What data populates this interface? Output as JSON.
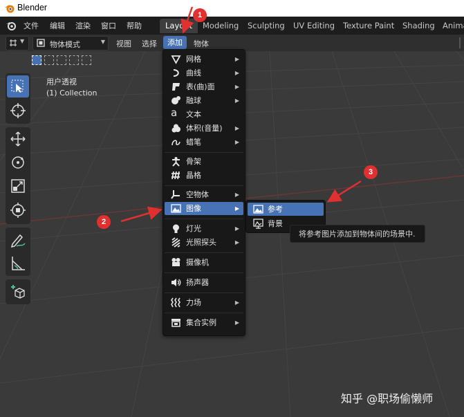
{
  "titlebar": {
    "title": "Blender"
  },
  "menubar": {
    "items": [
      "文件",
      "编辑",
      "渲染",
      "窗口",
      "帮助"
    ],
    "workspaces": [
      "Layout",
      "Modeling",
      "Sculpting",
      "UV Editing",
      "Texture Paint",
      "Shading",
      "Anima"
    ]
  },
  "toolbar": {
    "mode": "物体模式",
    "view": "视图",
    "select": "选择",
    "add": "添加",
    "object": "物体"
  },
  "viewport": {
    "title": "用户透视",
    "collection": "(1) Collection"
  },
  "add_menu": {
    "items": [
      {
        "label": "网格",
        "icon": "mesh-icon",
        "submenu": true
      },
      {
        "label": "曲线",
        "icon": "curve-icon",
        "submenu": true
      },
      {
        "label": "表(曲)面",
        "icon": "surface-icon",
        "submenu": true
      },
      {
        "label": "融球",
        "icon": "metaball-icon",
        "submenu": true
      },
      {
        "label": "文本",
        "icon": "text-icon",
        "submenu": false
      },
      {
        "label": "体积(音量)",
        "icon": "volume-icon",
        "submenu": true
      },
      {
        "label": "蜡笔",
        "icon": "grease-pencil-icon",
        "submenu": true
      },
      {
        "label": "骨架",
        "icon": "armature-icon",
        "submenu": false
      },
      {
        "label": "晶格",
        "icon": "lattice-icon",
        "submenu": false
      },
      {
        "label": "空物体",
        "icon": "empty-icon",
        "submenu": true
      },
      {
        "label": "图像",
        "icon": "image-icon",
        "submenu": true
      },
      {
        "label": "灯光",
        "icon": "light-icon",
        "submenu": true
      },
      {
        "label": "光照探头",
        "icon": "light-probe-icon",
        "submenu": true
      },
      {
        "label": "摄像机",
        "icon": "camera-icon",
        "submenu": false
      },
      {
        "label": "扬声器",
        "icon": "speaker-icon",
        "submenu": false
      },
      {
        "label": "力场",
        "icon": "force-field-icon",
        "submenu": true
      },
      {
        "label": "集合实例",
        "icon": "collection-instance-icon",
        "submenu": true
      }
    ]
  },
  "image_submenu": {
    "items": [
      {
        "label": "参考",
        "icon": "reference-image-icon"
      },
      {
        "label": "背景",
        "icon": "background-image-icon"
      }
    ]
  },
  "tooltip": "将参考图片添加到物体间的场景中.",
  "badges": [
    "1",
    "2",
    "3"
  ],
  "watermark": "知乎 @职场偷懒师",
  "colors": {
    "accent": "#4772b3",
    "badge": "#e03030",
    "arrow": "#e03030",
    "menu_bg": "#181818"
  }
}
